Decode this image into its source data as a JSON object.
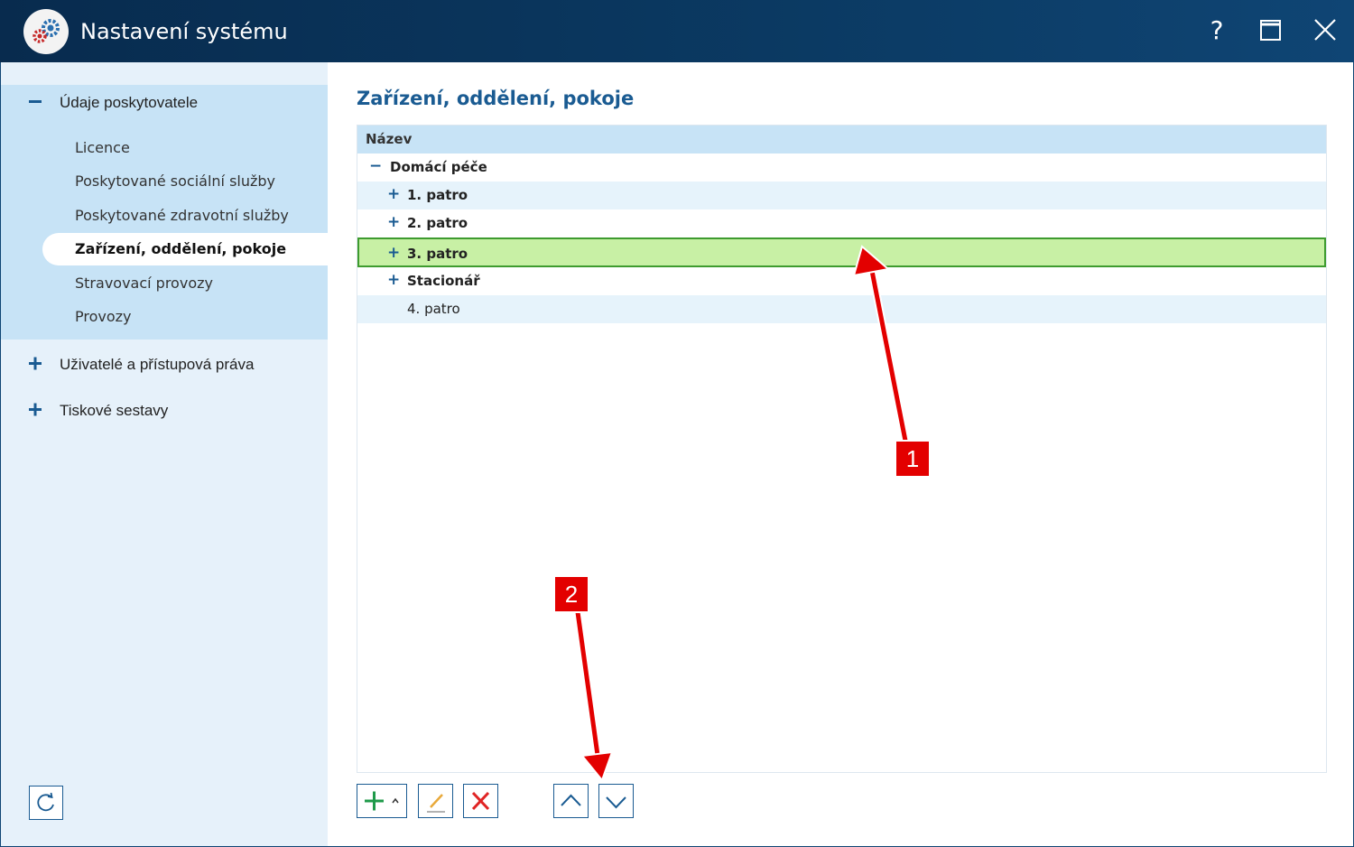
{
  "window": {
    "title": "Nastavení systému",
    "help_label": "?"
  },
  "sidebar": {
    "groups": [
      {
        "label": "Údaje poskytovatele",
        "expanded": true,
        "items": [
          {
            "label": "Licence"
          },
          {
            "label": "Poskytované sociální služby"
          },
          {
            "label": "Poskytované zdravotní služby"
          },
          {
            "label": "Zařízení, oddělení, pokoje",
            "active": true
          },
          {
            "label": "Stravovací provozy"
          },
          {
            "label": "Provozy"
          }
        ]
      },
      {
        "label": "Uživatelé a přístupová práva",
        "expanded": false
      },
      {
        "label": "Tiskové sestavy",
        "expanded": false
      }
    ]
  },
  "main": {
    "title": "Zařízení, oddělení, pokoje",
    "grid": {
      "column_header": "Název",
      "rows": [
        {
          "label": "Domácí péče",
          "level": 0,
          "toggle": "−",
          "bold": true
        },
        {
          "label": "1. patro",
          "level": 1,
          "toggle": "+",
          "bold": true
        },
        {
          "label": "2. patro",
          "level": 1,
          "toggle": "+",
          "bold": true
        },
        {
          "label": "3. patro",
          "level": 1,
          "toggle": "+",
          "bold": true,
          "selected": true
        },
        {
          "label": "Stacionář",
          "level": 1,
          "toggle": "+",
          "bold": true
        },
        {
          "label": "4. patro",
          "level": 2,
          "bold": false
        }
      ]
    }
  },
  "toolbar": {
    "add_icon": "plus-icon",
    "edit_icon": "pencil-icon",
    "delete_icon": "delete-x-icon",
    "move_up_icon": "chevron-up-icon",
    "move_down_icon": "chevron-down-icon"
  },
  "annotations": {
    "marker_1": "1",
    "marker_2": "2"
  },
  "colors": {
    "titlebar": "#0b3a63",
    "accent": "#1a5b92",
    "sidebar_bg": "#e6f1fa",
    "sidebar_group_bg": "#c7e3f6",
    "selected_row": "#c8f0a5",
    "marker": "#e30000"
  }
}
